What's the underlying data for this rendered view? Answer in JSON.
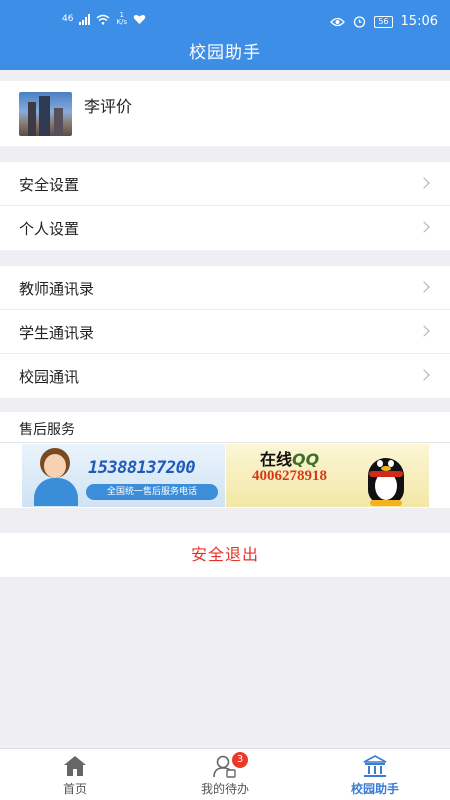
{
  "status_bar": {
    "network": "46",
    "speed_value": "1",
    "speed_unit": "K/s",
    "battery": "56",
    "time": "15:06"
  },
  "header": {
    "title": "校园助手"
  },
  "profile": {
    "name": "李评价"
  },
  "settings_group": [
    {
      "label": "安全设置"
    },
    {
      "label": "个人设置"
    }
  ],
  "contacts_group": [
    {
      "label": "教师通讯录"
    },
    {
      "label": "学生通讯录"
    },
    {
      "label": "校园通讯"
    }
  ],
  "after_sales": {
    "title": "售后服务",
    "phone_banner": {
      "number": "15388137200",
      "caption": "全国统一售后服务电话"
    },
    "qq_banner": {
      "label": "在线",
      "qq_text": "QQ",
      "number": "4006278918"
    }
  },
  "logout": {
    "label": "安全退出"
  },
  "bottom_nav": [
    {
      "label": "首页",
      "icon": "home-icon",
      "active": false
    },
    {
      "label": "我的待办",
      "icon": "user-task-icon",
      "active": false,
      "badge": "3"
    },
    {
      "label": "校园助手",
      "icon": "school-icon",
      "active": true
    }
  ],
  "colors": {
    "primary": "#3d8ee6",
    "logout": "#e2352a",
    "active_tab": "#3a7bd5",
    "badge": "#e9392b"
  }
}
